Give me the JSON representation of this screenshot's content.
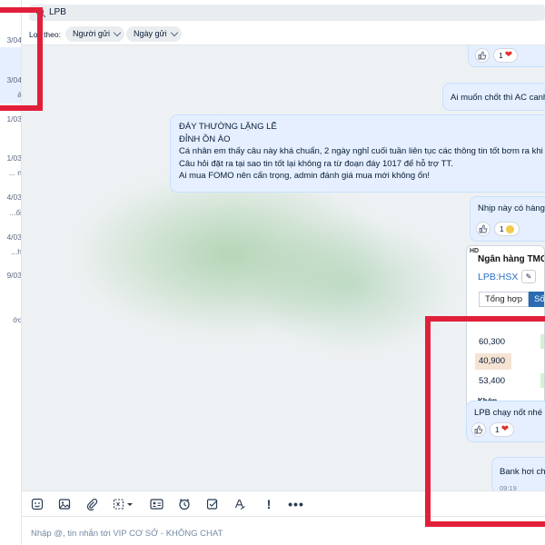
{
  "search": {
    "value": "LPB"
  },
  "filter": {
    "label": "Lọc theo:",
    "sender_chip": "Người gửi",
    "date_chip": "Ngày gửi"
  },
  "conversation_list_fragments": [
    {
      "text": "3/04"
    },
    {
      "text": "3/04"
    },
    {
      "text": "á"
    },
    {
      "text": "1/03"
    },
    {
      "text": "1/03"
    },
    {
      "text": "n ..."
    },
    {
      "text": "4/03"
    },
    {
      "text": "ối..."
    },
    {
      "text": "4/03"
    },
    {
      "text": "h..."
    },
    {
      "text": "9/03"
    },
    {
      "text": "ớc"
    }
  ],
  "messages": {
    "top_reaction_count": "1",
    "msg_1": "Ai muốn chốt thì AC canh",
    "msg_2_lines": [
      "ĐÁY THƯỜNG LẶNG LẼ",
      "ĐỈNH ỒN ÀO",
      "Cá nhân em thấy câu này khá chuẩn, 2 ngày nghỉ cuối tuần liên tục các thông tin tốt bơm ra khi",
      "Câu hỏi đặt ra tại sao tin tốt lại không ra từ đoạn đáy 1017 để hỗ trợ TT.",
      "Ai mua FOMO nên cẩn trọng, admin đánh giá mua mới không ổn!"
    ],
    "msg_3": "Nhịp này có hàng",
    "msg_3_reaction_count": "1",
    "msg_4": "LPB chạy nốt nhé c",
    "msg_4_reaction_count": "1",
    "msg_5": "Bank hơi chậ",
    "msg_5_time": "09:19"
  },
  "stock_card": {
    "badge": "HD",
    "title": "Ngân hàng TMC",
    "ticker": "LPB:HSX",
    "edit_icon": "pencil-icon",
    "tab_overview": "Tổng hợp",
    "tab_other": "Số",
    "prices": [
      "60,300",
      "40,900",
      "53,400"
    ],
    "section_label": "Khớp"
  },
  "composer": {
    "placeholder": "Nhập @, tin nhắn tới VIP CƠ SỞ - KHÔNG CHAT"
  },
  "colors": {
    "accent": "#2a6bb3",
    "bubble": "#e5efff",
    "annotation_red": "#e21f3a",
    "heart": "#e0312f"
  }
}
